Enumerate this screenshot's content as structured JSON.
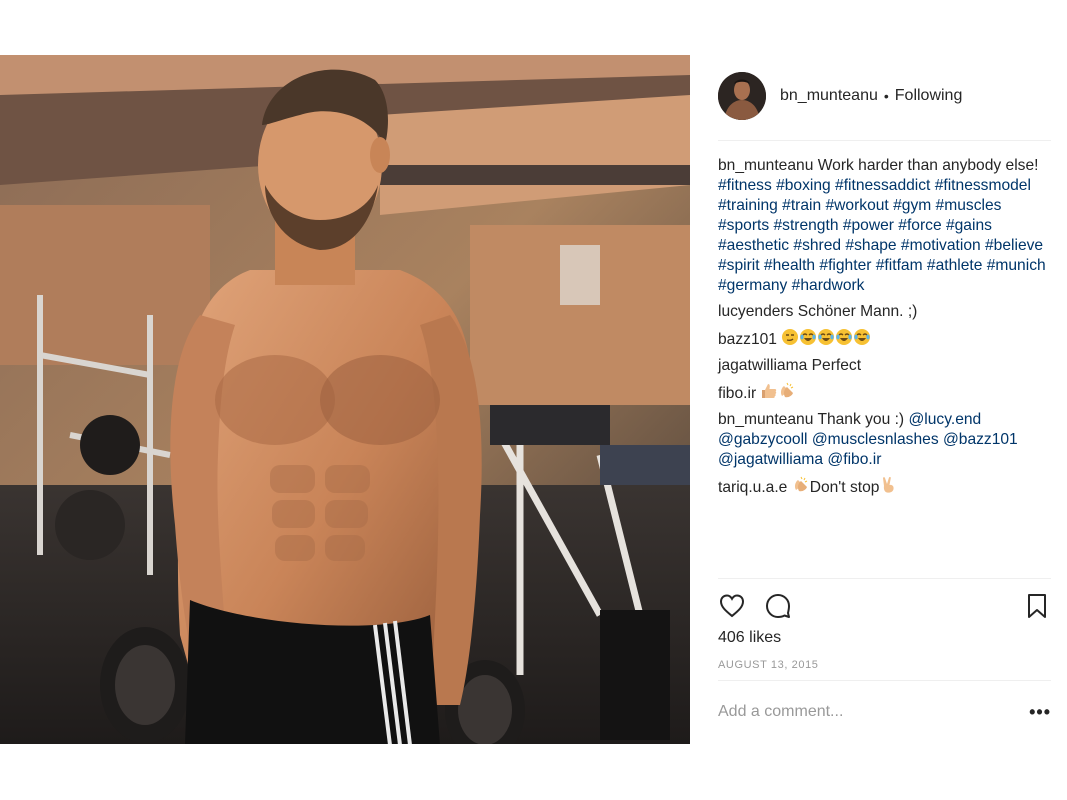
{
  "post": {
    "author": "bn_munteanu",
    "follow_status": "Following",
    "dot": "•",
    "likes": "406 likes",
    "date": "AUGUST 13, 2015",
    "comment_placeholder": "Add a comment...",
    "more_label": "•••",
    "photo_icon": "gym-photo",
    "avatar_icon": "profile-photo"
  },
  "caption": {
    "user": "bn_munteanu",
    "text": "Work harder than anybody else!",
    "hashtags": "#fitness #boxing #fitnessaddict #fitnessmodel #training #train #workout #gym #muscles #sports #strength #power #force #gains #aesthetic #shred #shape #motivation #believe #spirit #health #fighter #fitfam #athlete #munich #germany #hardwork"
  },
  "comments": [
    {
      "user": "lucyenders",
      "text": "Schöner Mann. ;)"
    },
    {
      "user": "bazz101",
      "text": "",
      "emojis": [
        "smirk-emoji",
        "tears-of-joy-emoji",
        "tears-of-joy-emoji",
        "tears-of-joy-emoji",
        "tears-of-joy-emoji"
      ]
    },
    {
      "user": "jagatwilliama",
      "text": "Perfect"
    },
    {
      "user": "fibo.ir",
      "text": "",
      "emojis": [
        "thumbs-up-emoji",
        "clapping-hands-emoji"
      ]
    },
    {
      "user": "bn_munteanu",
      "text": "Thank you :)",
      "mentions": "@lucy.end @gabzycooll @musclesnlashes @bazz101 @jagatwilliama @fibo.ir"
    },
    {
      "user": "tariq.u.a.e",
      "text": "Don't stop",
      "emojis": [
        "clapping-hands-emoji",
        "victory-hand-emoji"
      ]
    }
  ],
  "icons": {
    "like": "heart-icon",
    "comment": "comment-icon",
    "save": "bookmark-icon"
  },
  "colors": {
    "link": "#003569",
    "text": "#262626",
    "muted": "#999999",
    "divider": "#efefef"
  }
}
